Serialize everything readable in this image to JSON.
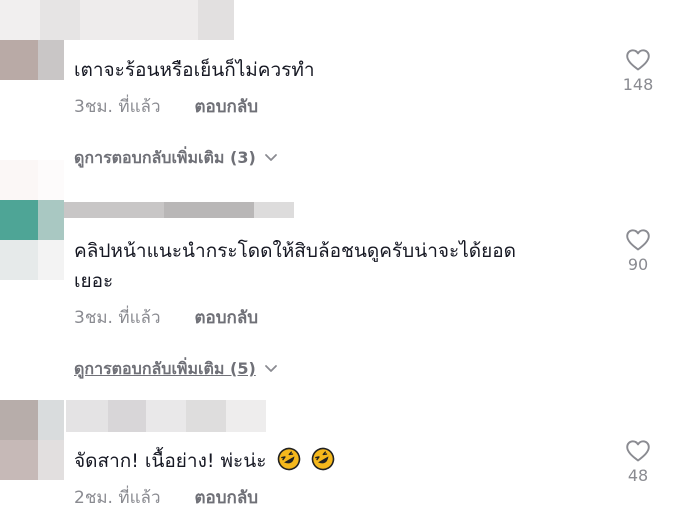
{
  "comments": [
    {
      "text": "เตาจะร้อนหรือเย็นก็ไม่ควรทำ",
      "time": "3ชม. ที่แล้ว",
      "reply_label": "ตอบกลับ",
      "likes": "148",
      "view_more": "ดูการตอบกลับเพิ่มเติม (3)"
    },
    {
      "text_line1": "คลิปหน้าแนะนำกระโดดให้สิบล้อชนดูครับน่าจะได้ยอด",
      "text_line2": "เยอะ",
      "time": "3ชม. ที่แล้ว",
      "reply_label": "ตอบกลับ",
      "likes": "90",
      "view_more": "ดูการตอบกลับเพิ่มเติม (5)"
    },
    {
      "text": "จัดสาก! เนื้อย่าง! พ่ะน่ะ",
      "time": "2ชม. ที่แล้ว",
      "reply_label": "ตอบกลับ",
      "likes": "48",
      "emoji": [
        "rolling-on-floor-laughing",
        "rolling-on-floor-laughing"
      ]
    }
  ],
  "icons": {
    "like": "heart-outline-icon",
    "expand": "chevron-down-icon"
  },
  "colors": {
    "text": "#161823",
    "muted": "#8a8b91",
    "emoji": "#f5b81c"
  }
}
